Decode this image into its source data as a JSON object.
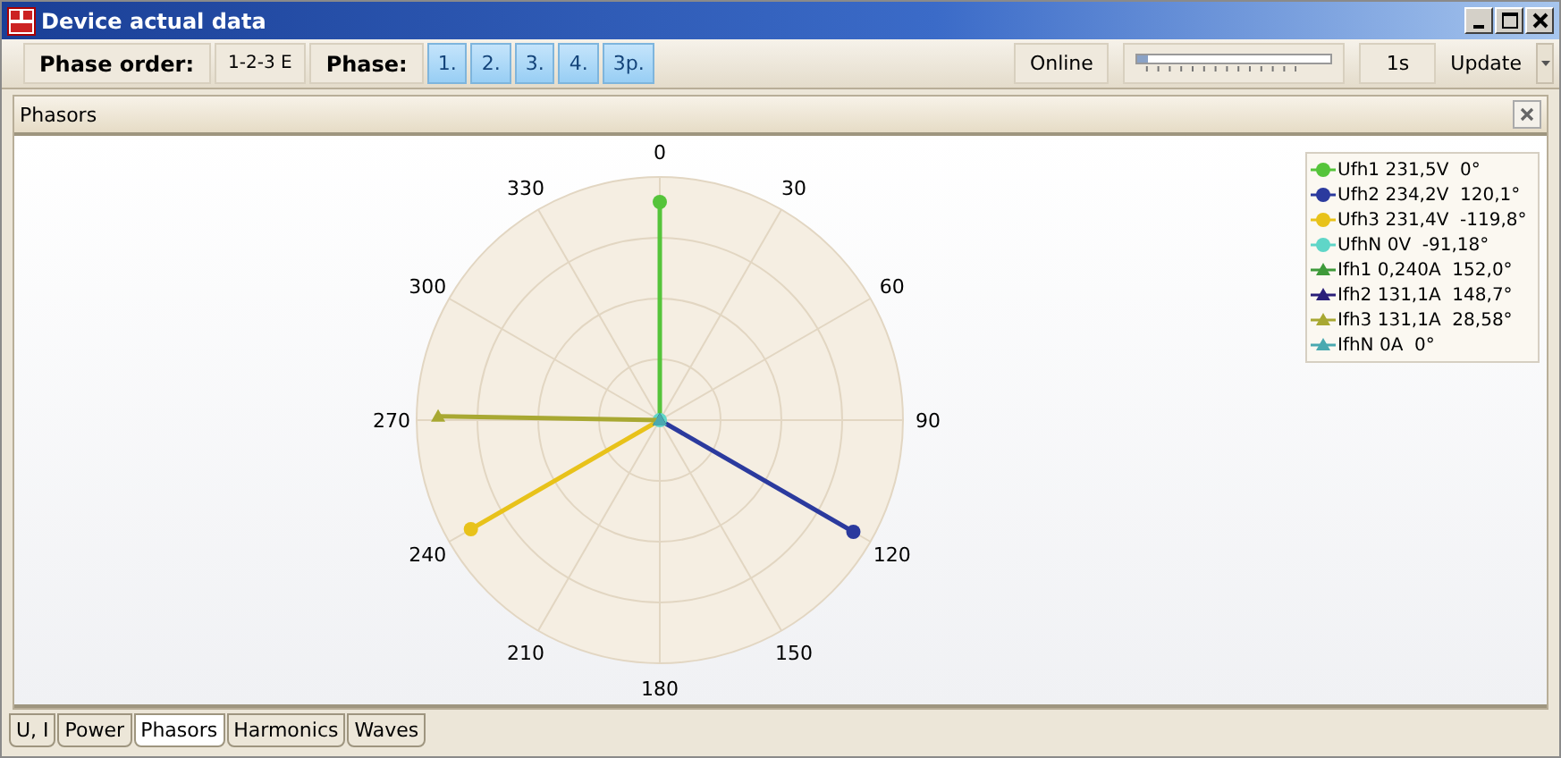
{
  "window": {
    "title": "Device actual data"
  },
  "toolbar": {
    "phase_order_label": "Phase order:",
    "phase_order_value": "1-2-3 E",
    "phase_label": "Phase:",
    "phases": [
      {
        "label": "1.",
        "selected": true
      },
      {
        "label": "2.",
        "selected": true
      },
      {
        "label": "3.",
        "selected": true
      },
      {
        "label": "4.",
        "selected": true
      },
      {
        "label": "3p.",
        "selected": true
      }
    ],
    "status": "Online",
    "slider": {
      "level": 0.05
    },
    "interval": "1s",
    "update": "Update"
  },
  "panel": {
    "title": "Phasors"
  },
  "angle_labels": [
    "0",
    "30",
    "60",
    "90",
    "120",
    "150",
    "180",
    "210",
    "240",
    "270",
    "300",
    "330"
  ],
  "legend": [
    {
      "text": "Ufh1 231,5V  0°",
      "color": "#55c43a",
      "kind": "circle"
    },
    {
      "text": "Ufh2 234,2V  120,1°",
      "color": "#2b3a9e",
      "kind": "circle"
    },
    {
      "text": "Ufh3 231,4V  -119,8°",
      "color": "#e8c21a",
      "kind": "circle"
    },
    {
      "text": "UfhN 0V  -91,18°",
      "color": "#5fd6c8",
      "kind": "circle"
    },
    {
      "text": "Ifh1 0,240A  152,0°",
      "color": "#3e9a3a",
      "kind": "triangle"
    },
    {
      "text": "Ifh2 131,1A  148,7°",
      "color": "#2a1f7a",
      "kind": "triangle"
    },
    {
      "text": "Ifh3 131,1A  28,58°",
      "color": "#a8a832",
      "kind": "triangle"
    },
    {
      "text": "IfhN 0A  0°",
      "color": "#4aa9b0",
      "kind": "triangle"
    }
  ],
  "tabs": [
    {
      "label": "U, I",
      "selected": false
    },
    {
      "label": "Power",
      "selected": false
    },
    {
      "label": "Phasors",
      "selected": true
    },
    {
      "label": "Harmonics",
      "selected": false
    },
    {
      "label": "Waves",
      "selected": false
    }
  ]
}
